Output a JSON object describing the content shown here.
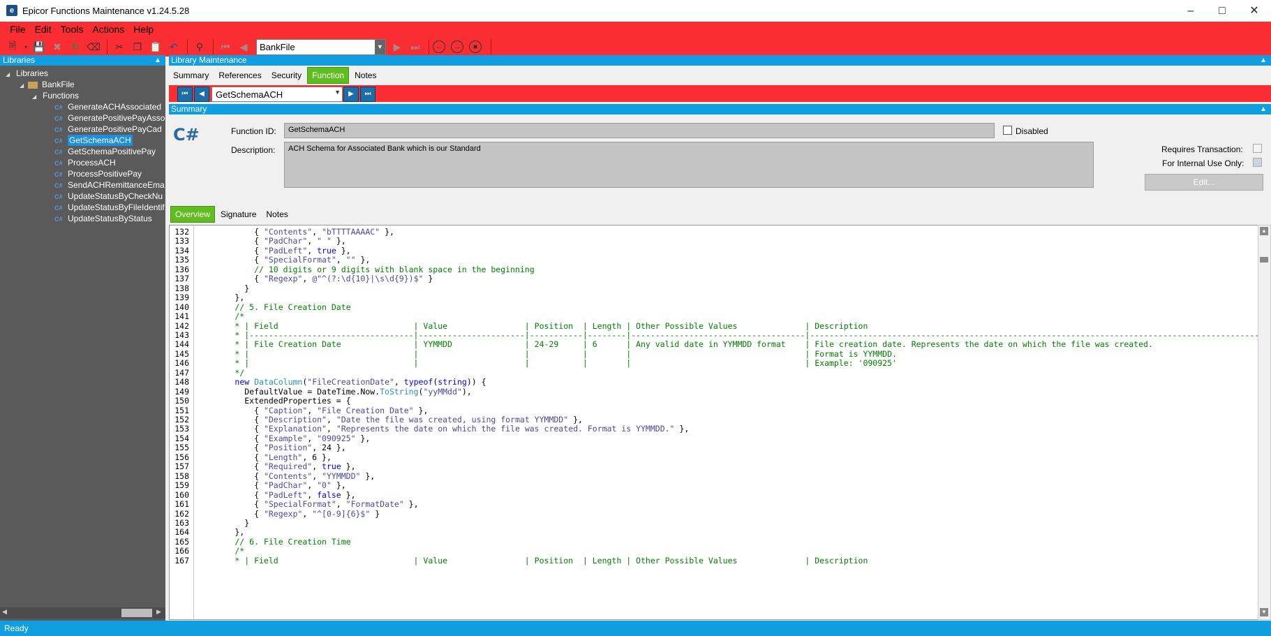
{
  "window": {
    "title": "Epicor Functions Maintenance v1.24.5.28",
    "icon": "epicor-logo-icon"
  },
  "menu": {
    "items": [
      "File",
      "Edit",
      "Tools",
      "Actions",
      "Help"
    ]
  },
  "toolbar": {
    "library_select": "BankFile"
  },
  "libraries_panel": {
    "header": "Libraries",
    "root": "Libraries",
    "library": "BankFile",
    "functions_folder": "Functions",
    "functions": [
      "GenerateACHAssociated",
      "GeneratePositivePayAsso",
      "GeneratePositivePayCad",
      "GetSchemaACH",
      "GetSchemaPositivePay",
      "ProcessACH",
      "ProcessPositivePay",
      "SendACHRemittanceEma",
      "UpdateStatusByCheckNu",
      "UpdateStatusByFileIdentif",
      "UpdateStatusByStatus"
    ],
    "selected": "GetSchemaACH"
  },
  "library_maintenance": {
    "header": "Library Maintenance",
    "tabs": [
      "Summary",
      "References",
      "Security",
      "Function",
      "Notes"
    ],
    "active_tab": "Function",
    "function_select": "GetSchemaACH"
  },
  "summary": {
    "header": "Summary",
    "icon_text": "C#",
    "function_id_label": "Function ID:",
    "function_id": "GetSchemaACH",
    "disabled_label": "Disabled",
    "description_label": "Description:",
    "description": "ACH Schema for Associated Bank which is our Standard",
    "requires_transaction_label": "Requires Transaction:",
    "internal_use_label": "For Internal Use Only:",
    "edit_button": "Edit..."
  },
  "sub_tabs": [
    "Overview",
    "Signature",
    "Notes"
  ],
  "status": "Ready",
  "code": {
    "lines": [
      {
        "n": "132",
        "t": "            { \"Contents\", \"bTTTTAAAAC\" },"
      },
      {
        "n": "133",
        "t": "            { \"PadChar\", \" \" },"
      },
      {
        "n": "134",
        "t": "            { \"PadLeft\", true },"
      },
      {
        "n": "135",
        "t": "            { \"SpecialFormat\", \"\" },"
      },
      {
        "n": "136",
        "t": "            // 10 digits or 9 digits with blank space in the beginning"
      },
      {
        "n": "137",
        "t": "            { \"Regexp\", @\"^(?:\\d{10}|\\s\\d{9})$\" }"
      },
      {
        "n": "138",
        "t": "          }"
      },
      {
        "n": "139",
        "t": "        },"
      },
      {
        "n": "140",
        "t": "        // 5. File Creation Date"
      },
      {
        "n": "141",
        "t": "        /*"
      },
      {
        "n": "142",
        "t": "        * | Field                            | Value                | Position  | Length | Other Possible Values              | Description                                                                                  |"
      },
      {
        "n": "143",
        "t": "        * |----------------------------------|----------------------|-----------|--------|------------------------------------|----------------------------------------------------------------------------------------------|"
      },
      {
        "n": "144",
        "t": "        * | File Creation Date               | YYMMDD               | 24-29     | 6      | Any valid date in YYMMDD format    | File creation date. Represents the date on which the file was created.                      |"
      },
      {
        "n": "145",
        "t": "        * |                                  |                      |           |        |                                    | Format is YYMMDD.                                                                            |"
      },
      {
        "n": "146",
        "t": "        * |                                  |                      |           |        |                                    | Example: '090925'                                                                            |"
      },
      {
        "n": "147",
        "t": "        */"
      },
      {
        "n": "148",
        "t": "        new DataColumn(\"FileCreationDate\", typeof(string)) {"
      },
      {
        "n": "149",
        "t": "          DefaultValue = DateTime.Now.ToString(\"yyMMdd\"),"
      },
      {
        "n": "150",
        "t": "          ExtendedProperties = {"
      },
      {
        "n": "151",
        "t": "            { \"Caption\", \"File Creation Date\" },"
      },
      {
        "n": "152",
        "t": "            { \"Description\", \"Date the file was created, using format YYMMDD\" },"
      },
      {
        "n": "153",
        "t": "            { \"Explanation\", \"Represents the date on which the file was created. Format is YYMMDD.\" },"
      },
      {
        "n": "154",
        "t": "            { \"Example\", \"090925\" },"
      },
      {
        "n": "155",
        "t": "            { \"Position\", 24 },"
      },
      {
        "n": "156",
        "t": "            { \"Length\", 6 },"
      },
      {
        "n": "157",
        "t": "            { \"Required\", true },"
      },
      {
        "n": "158",
        "t": "            { \"Contents\", \"YYMMDD\" },"
      },
      {
        "n": "159",
        "t": "            { \"PadChar\", \"0\" },"
      },
      {
        "n": "160",
        "t": "            { \"PadLeft\", false },"
      },
      {
        "n": "161",
        "t": "            { \"SpecialFormat\", \"FormatDate\" },"
      },
      {
        "n": "162",
        "t": "            { \"Regexp\", \"^[0-9]{6}$\" }"
      },
      {
        "n": "163",
        "t": "          }"
      },
      {
        "n": "164",
        "t": "        },"
      },
      {
        "n": "165",
        "t": "        // 6. File Creation Time"
      },
      {
        "n": "166",
        "t": "        /*"
      },
      {
        "n": "167",
        "t": "        * | Field                            | Value                | Position  | Length | Other Possible Values              | Description                                                                                  |"
      }
    ]
  },
  "colors": {
    "brand_red": "#fa2e32",
    "header_blue": "#109ee0",
    "active_tab_green": "#5fbd1f"
  }
}
